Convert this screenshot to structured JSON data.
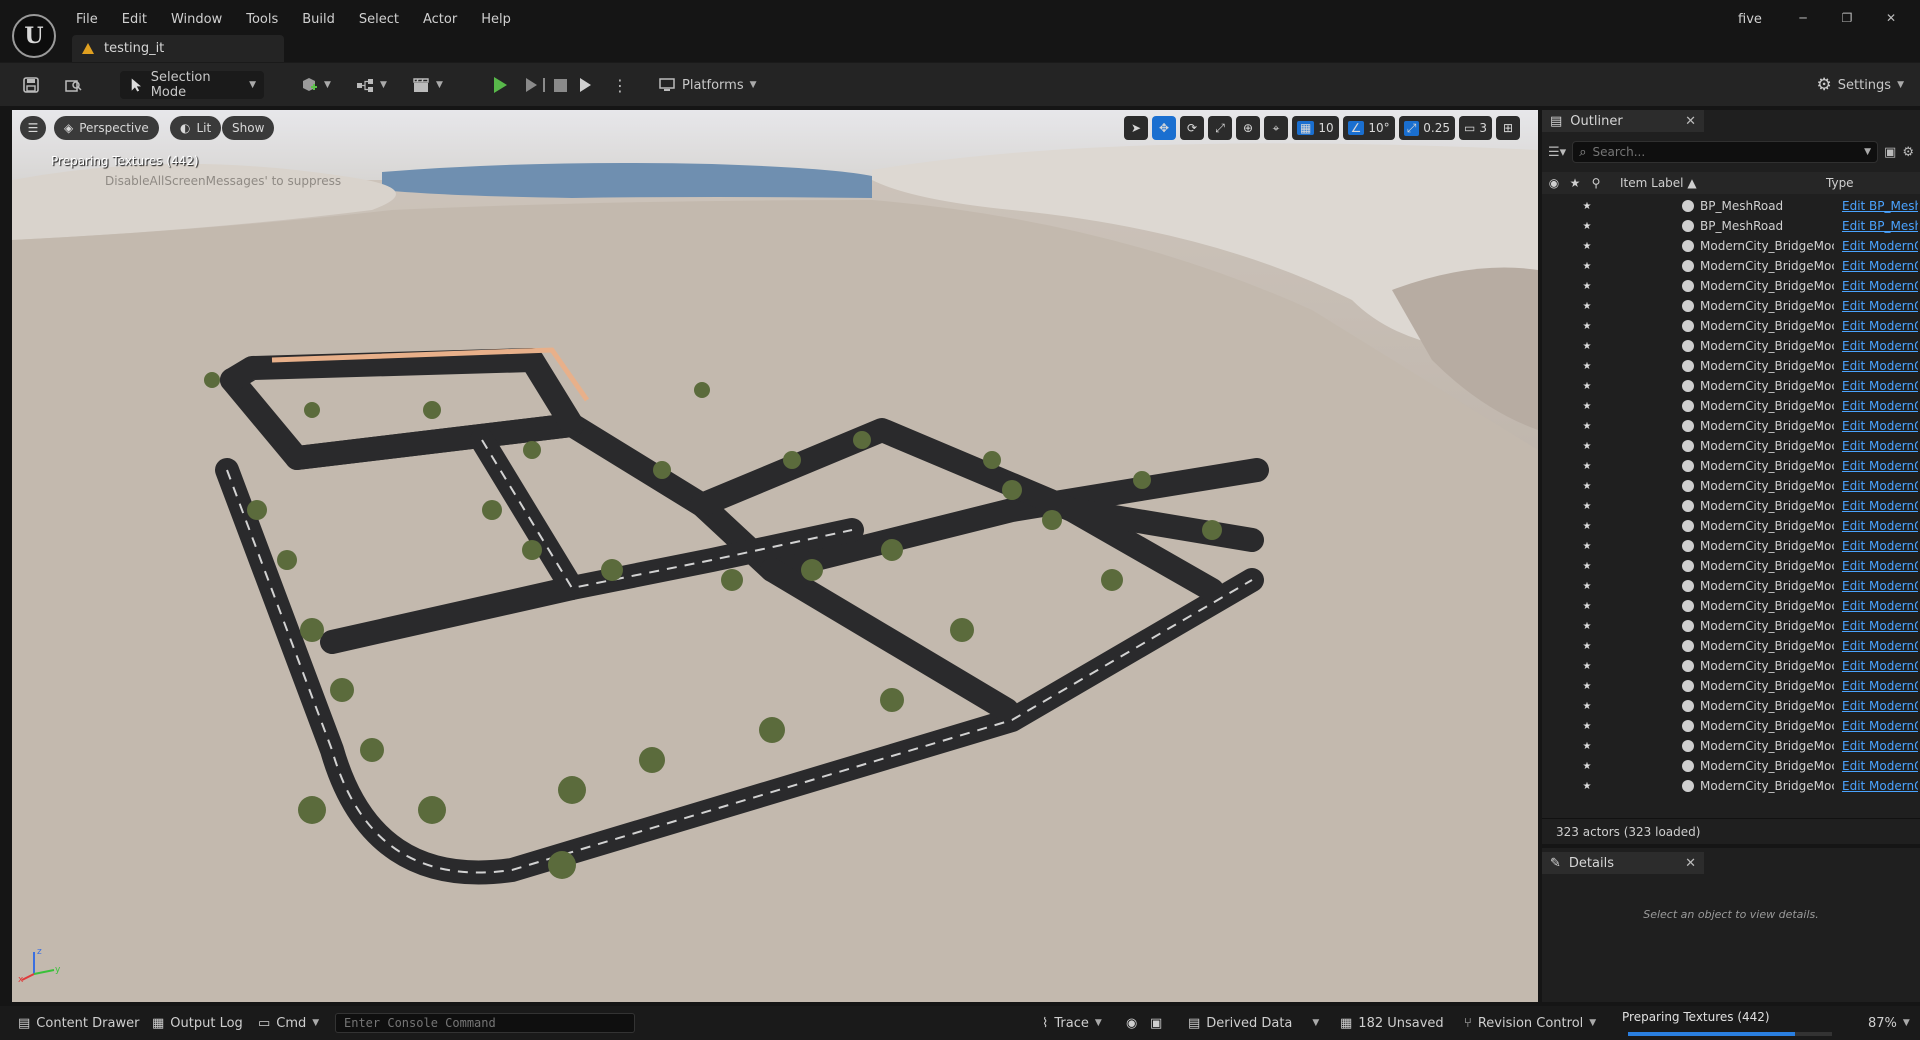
{
  "menu": [
    "File",
    "Edit",
    "Window",
    "Tools",
    "Build",
    "Select",
    "Actor",
    "Help"
  ],
  "level_tab": "testing_it",
  "project_name": "five",
  "toolbar": {
    "mode": "Selection Mode",
    "platforms": "Platforms",
    "settings": "Settings"
  },
  "viewport": {
    "perspective": "Perspective",
    "lit": "Lit",
    "show": "Show",
    "grid_snap": "10",
    "rot_snap": "10°",
    "scale_snap": "0.25",
    "camera_speed": "3",
    "msg_preparing": "Preparing Textures (442)",
    "msg_suppress": "DisableAllScreenMessages' to suppress"
  },
  "outliner": {
    "title": "Outliner",
    "search_placeholder": "Search...",
    "col_label": "Item Label ▲",
    "col_type": "Type",
    "rows": [
      {
        "label": "BP_MeshRoad",
        "type": "Edit BP_Mesh"
      },
      {
        "label": "BP_MeshRoad",
        "type": "Edit BP_Mesh"
      },
      {
        "label": "ModernCity_BridgeMoc",
        "type": "Edit ModernC"
      },
      {
        "label": "ModernCity_BridgeMoc",
        "type": "Edit ModernC"
      },
      {
        "label": "ModernCity_BridgeMoc",
        "type": "Edit ModernC"
      },
      {
        "label": "ModernCity_BridgeMoc",
        "type": "Edit ModernC"
      },
      {
        "label": "ModernCity_BridgeMoc",
        "type": "Edit ModernC"
      },
      {
        "label": "ModernCity_BridgeMoc",
        "type": "Edit ModernC"
      },
      {
        "label": "ModernCity_BridgeMoc",
        "type": "Edit ModernC"
      },
      {
        "label": "ModernCity_BridgeMoc",
        "type": "Edit ModernC"
      },
      {
        "label": "ModernCity_BridgeMoc",
        "type": "Edit ModernC"
      },
      {
        "label": "ModernCity_BridgeMoc",
        "type": "Edit ModernC"
      },
      {
        "label": "ModernCity_BridgeMoc",
        "type": "Edit ModernC"
      },
      {
        "label": "ModernCity_BridgeMoc",
        "type": "Edit ModernC"
      },
      {
        "label": "ModernCity_BridgeMoc",
        "type": "Edit ModernC"
      },
      {
        "label": "ModernCity_BridgeMoc",
        "type": "Edit ModernC"
      },
      {
        "label": "ModernCity_BridgeMoc",
        "type": "Edit ModernC"
      },
      {
        "label": "ModernCity_BridgeMoc",
        "type": "Edit ModernC"
      },
      {
        "label": "ModernCity_BridgeMoc",
        "type": "Edit ModernC"
      },
      {
        "label": "ModernCity_BridgeMoc",
        "type": "Edit ModernC"
      },
      {
        "label": "ModernCity_BridgeMoc",
        "type": "Edit ModernC"
      },
      {
        "label": "ModernCity_BridgeMoc",
        "type": "Edit ModernC"
      },
      {
        "label": "ModernCity_BridgeMoc",
        "type": "Edit ModernC"
      },
      {
        "label": "ModernCity_BridgeMoc",
        "type": "Edit ModernC"
      },
      {
        "label": "ModernCity_BridgeMoc",
        "type": "Edit ModernC"
      },
      {
        "label": "ModernCity_BridgeMoc",
        "type": "Edit ModernC"
      },
      {
        "label": "ModernCity_BridgeMoc",
        "type": "Edit ModernC"
      },
      {
        "label": "ModernCity_BridgeMoc",
        "type": "Edit ModernC"
      },
      {
        "label": "ModernCity_BridgeMoc",
        "type": "Edit ModernC"
      },
      {
        "label": "ModernCity_BridgeMoc",
        "type": "Edit ModernC"
      }
    ],
    "footer": "323 actors (323 loaded)"
  },
  "details": {
    "title": "Details",
    "empty_text": "Select an object to view details."
  },
  "statusbar": {
    "content_drawer": "Content Drawer",
    "output_log": "Output Log",
    "cmd": "Cmd",
    "console_placeholder": "Enter Console Command",
    "trace": "Trace",
    "derived_data": "Derived Data",
    "unsaved": "182 Unsaved",
    "revision_control": "Revision Control",
    "progress_label": "Preparing Textures (442)",
    "progress_fraction": 0.82,
    "progress_percent": "87%"
  }
}
